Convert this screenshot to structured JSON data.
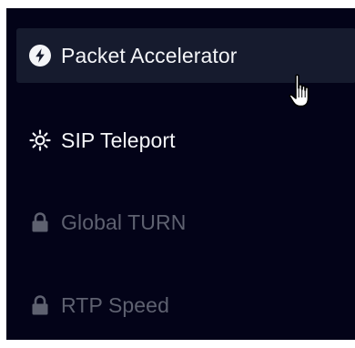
{
  "menu": {
    "items": [
      {
        "label": "Packet Accelerator",
        "icon": "bolt-icon",
        "state": "active"
      },
      {
        "label": "SIP Teleport",
        "icon": "sun-icon",
        "state": "enabled"
      },
      {
        "label": "Global TURN",
        "icon": "lock-icon",
        "state": "locked"
      },
      {
        "label": "RTP Speed",
        "icon": "lock-icon",
        "state": "locked"
      }
    ]
  },
  "colors": {
    "panel_background": "#030318",
    "active_item_background": "#161b2e",
    "enabled_text": "#f4f5f8",
    "locked_text": "#5e6170"
  }
}
